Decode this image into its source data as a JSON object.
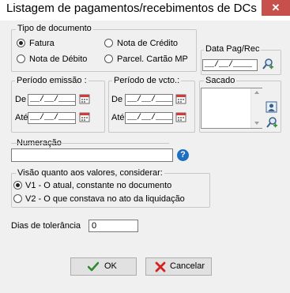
{
  "window": {
    "title": "Listagem de pagamentos/recebimentos de DCs",
    "close_glyph": "✕"
  },
  "tipo_documento": {
    "title": "Tipo de documento",
    "options": [
      {
        "label": "Fatura",
        "selected": true
      },
      {
        "label": "Nota de Crédito",
        "selected": false
      },
      {
        "label": "Nota de Débito",
        "selected": false
      },
      {
        "label": "Parcel. Cartão MP",
        "selected": false
      }
    ]
  },
  "data_pag_rec": {
    "title": "Data Pag/Rec",
    "value": "__/__/____",
    "search_icon": "magnifier-add-icon"
  },
  "periodo_emissao": {
    "title": "Período emissão :",
    "de_label": "De",
    "ate_label": "Até",
    "de_value": "__/__/____",
    "ate_value": "__/__/____"
  },
  "periodo_vcto": {
    "title": "Período de vcto.:",
    "de_label": "De",
    "ate_label": "Até",
    "de_value": "__/__/____",
    "ate_value": "__/__/____"
  },
  "sacado": {
    "title": "Sacado",
    "items": []
  },
  "numeracao": {
    "title": "Numeração",
    "value": "",
    "help_glyph": "?"
  },
  "visao": {
    "title": "Visão quanto aos valores, considerar:",
    "options": [
      {
        "label": "V1 - O atual, constante no documento",
        "selected": true
      },
      {
        "label": "V2 - O que constava no ato da liquidação",
        "selected": false
      }
    ]
  },
  "tolerancia": {
    "label": "Dias de tolerância",
    "value": "0"
  },
  "buttons": {
    "ok": "OK",
    "cancel": "Cancelar"
  },
  "colors": {
    "close_bg": "#c7504d",
    "ok_check": "#2e8b2e",
    "cancel_x": "#d42020",
    "help_blue": "#1f6fc0"
  }
}
